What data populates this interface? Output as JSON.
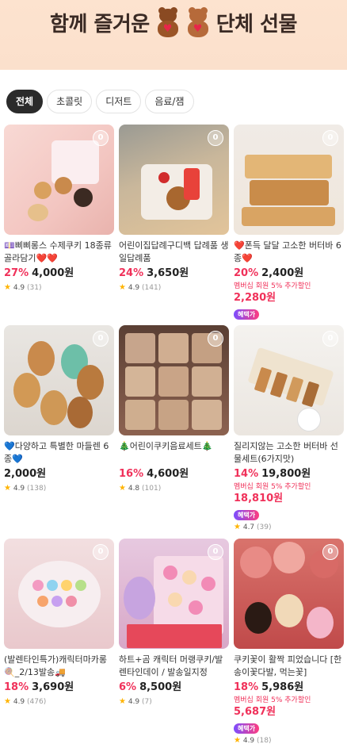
{
  "banner": {
    "title_left": "함께 즐거운",
    "title_right": "단체 선물"
  },
  "tabs": [
    {
      "label": "전체",
      "active": true
    },
    {
      "label": "초콜릿",
      "active": false
    },
    {
      "label": "디저트",
      "active": false
    },
    {
      "label": "음료/잼",
      "active": false
    }
  ],
  "wish_icon_text": "0",
  "products": [
    {
      "name": "💷삐삐롱스 수제쿠키 18종류 골라담기❤️❤️",
      "discount": "27%",
      "price": "4,000원",
      "member_text": "",
      "member_price": "",
      "badge": "",
      "rating": "4.9",
      "reviews": "(31)"
    },
    {
      "name": "어린이집답례구디백 답례품 생일답례품",
      "discount": "24%",
      "price": "3,650원",
      "member_text": "",
      "member_price": "",
      "badge": "",
      "rating": "4.9",
      "reviews": "(141)"
    },
    {
      "name": "❤️폰득 달달 고소한 버터바 6종❤️",
      "discount": "20%",
      "price": "2,400원",
      "member_text": "멤버십 회원 5% 추가할인",
      "member_price": "2,280원",
      "badge": "혜택가",
      "rating": "",
      "reviews": ""
    },
    {
      "name": "💙다양하고 특별한 마들렌 6종💙",
      "discount": "",
      "price": "2,000원",
      "member_text": "",
      "member_price": "",
      "badge": "",
      "rating": "4.9",
      "reviews": "(138)"
    },
    {
      "name": "🎄어린이쿠키음료세트🎄",
      "discount": "16%",
      "price": "4,600원",
      "member_text": "",
      "member_price": "",
      "badge": "",
      "rating": "4.8",
      "reviews": "(101)"
    },
    {
      "name": "질리지않는 고소한 버터바 선물세트(6가지맛)",
      "discount": "14%",
      "price": "19,800원",
      "member_text": "멤버십 회원 5% 추가할인",
      "member_price": "18,810원",
      "badge": "혜택가",
      "rating": "4.7",
      "reviews": "(39)"
    },
    {
      "name": "(발렌타인특가)캐릭터마카롱🍭_2/13발송🚚",
      "discount": "18%",
      "price": "3,690원",
      "member_text": "",
      "member_price": "",
      "badge": "",
      "rating": "4.9",
      "reviews": "(476)"
    },
    {
      "name": "하트+곰 캐릭터 머랭쿠키/발렌타인데이 / 발송일지정",
      "discount": "6%",
      "price": "8,500원",
      "member_text": "",
      "member_price": "",
      "badge": "",
      "rating": "4.9",
      "reviews": "(7)"
    },
    {
      "name": "쿠키꽃이 활짝 피었습니다 [한송이꽃다발, 먹는꽃]",
      "discount": "18%",
      "price": "5,986원",
      "member_text": "멤버십 회원 5% 추가할인",
      "member_price": "5,687원",
      "badge": "혜택가",
      "rating": "4.9",
      "reviews": "(18)"
    }
  ]
}
